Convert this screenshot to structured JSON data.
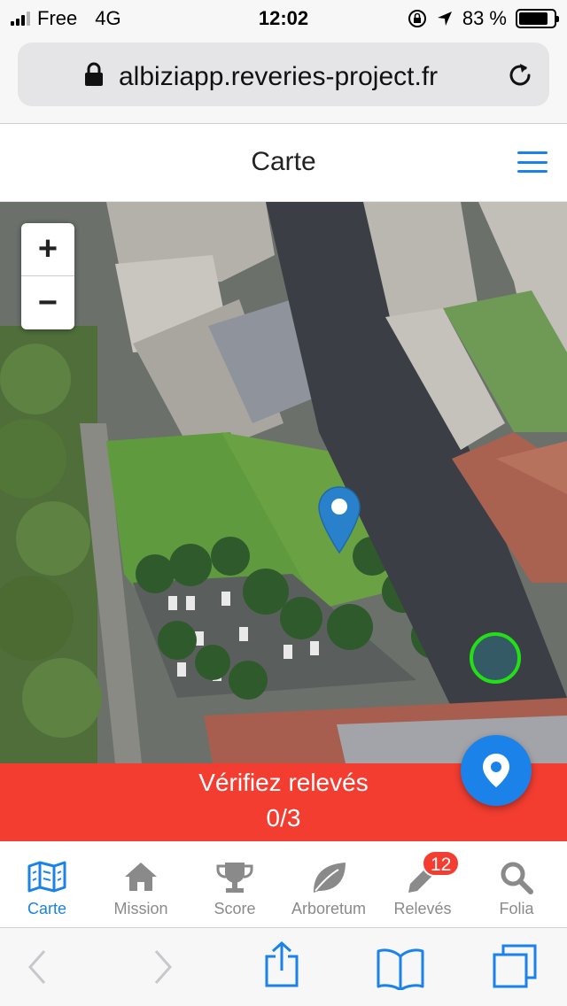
{
  "status": {
    "carrier": "Free",
    "network": "4G",
    "time": "12:02",
    "battery": "83 %",
    "battery_level": 0.83
  },
  "browser": {
    "url": "albiziapp.reveries-project.fr"
  },
  "header": {
    "title": "Carte"
  },
  "map": {
    "zoom_in": "+",
    "zoom_out": "−"
  },
  "verify": {
    "label": "Vérifiez relevés",
    "count": "0/3"
  },
  "nav": {
    "items": [
      {
        "label": "Carte",
        "icon": "map-icon"
      },
      {
        "label": "Mission",
        "icon": "home-icon"
      },
      {
        "label": "Score",
        "icon": "trophy-icon"
      },
      {
        "label": "Arboretum",
        "icon": "leaf-icon"
      },
      {
        "label": "Relevés",
        "icon": "pencil-icon",
        "badge": "12"
      },
      {
        "label": "Folia",
        "icon": "search-icon"
      }
    ]
  },
  "colors": {
    "accent": "#1a82e8",
    "banner": "#f23d30",
    "location_ring": "#23e016"
  }
}
